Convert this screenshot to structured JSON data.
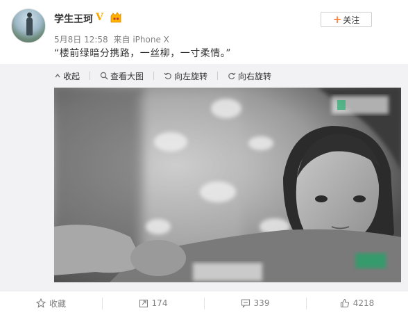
{
  "post": {
    "username": "学生王珂",
    "verified_badge": "V",
    "meta": {
      "date": "5月8日 12:58",
      "source": "来自 iPhone X"
    },
    "follow_label": "关注",
    "text": "“楼前绿暗分携路，一丝柳，一寸柔情。”"
  },
  "toolbar": {
    "collapse": "收起",
    "view_large": "查看大图",
    "rotate_left": "向左旋转",
    "rotate_right": "向右旋转"
  },
  "actions": {
    "favorite": "收藏",
    "repost": "174",
    "comment": "339",
    "like": "4218"
  },
  "colors": {
    "follow_plus": "#ff8140",
    "verified": "#f7a600",
    "muted_text": "#808080"
  },
  "icons": [
    "avatar",
    "verified-v-icon",
    "level-badge-icon",
    "collapse-icon",
    "view-large-icon",
    "rotate-left-icon",
    "rotate-right-icon",
    "star-icon",
    "repost-icon",
    "comment-icon",
    "thumb-up-icon"
  ]
}
